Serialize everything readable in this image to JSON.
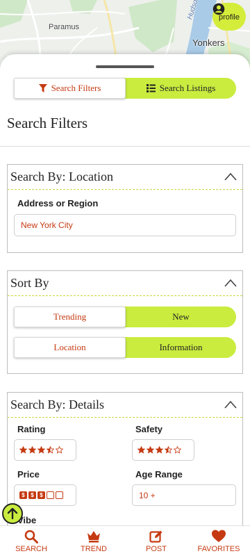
{
  "map": {
    "labels": {
      "paramus": "Paramus",
      "yonkers": "Yonkers",
      "hudson": "Hudson"
    },
    "profile_label": "profile"
  },
  "tabs": {
    "search_filters": "Search Filters",
    "search_listings": "Search Listings",
    "active": "search_filters"
  },
  "page_title": "Search Filters",
  "location_card": {
    "title": "Search By: Location",
    "address_label": "Address or Region",
    "address_value": "New York City"
  },
  "sort_card": {
    "title": "Sort By",
    "row1": {
      "left": "Trending",
      "right": "New"
    },
    "row2": {
      "left": "Location",
      "right": "Information"
    }
  },
  "details_card": {
    "title": "Search By: Details",
    "rating_label": "Rating",
    "rating_value": 3.5,
    "safety_label": "Safety",
    "safety_value": 3.5,
    "price_label": "Price",
    "price_value": 3,
    "price_max": 5,
    "price_symbol": "$",
    "age_label": "Age Range",
    "age_value": "10 +",
    "vibe_label": "Vibe"
  },
  "nav": [
    {
      "label": "SEARCH",
      "icon": "search-icon"
    },
    {
      "label": "TREND",
      "icon": "crown-icon"
    },
    {
      "label": "POST",
      "icon": "edit-icon"
    },
    {
      "label": "FAVORITES",
      "icon": "heart-icon"
    }
  ],
  "colors": {
    "accent": "#c9ec3f",
    "brand": "#c53a12",
    "profile_bg": "#d4ed3a"
  }
}
